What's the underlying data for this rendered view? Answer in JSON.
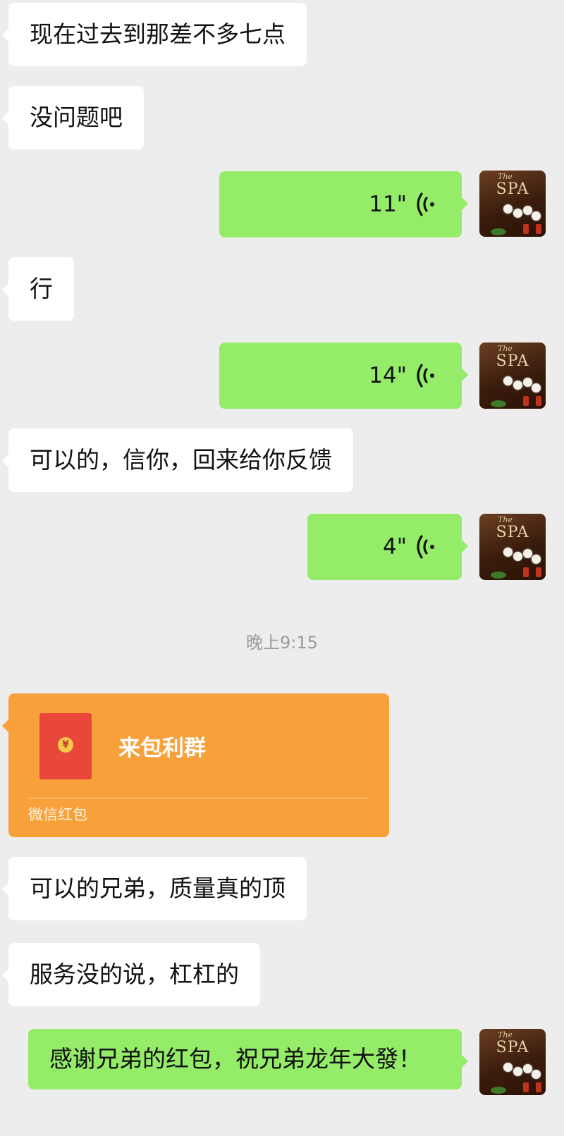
{
  "messages": {
    "m1": "现在过去到那差不多七点",
    "m2": "没问题吧",
    "voice1": "11\"",
    "m3": "行",
    "voice2": "14\"",
    "m4": "可以的，信你，回来给你反馈",
    "voice3": "4\"",
    "timestamp": "晚上9:15",
    "red_packet": {
      "title": "来包利群",
      "label": "微信红包",
      "coin": "¥"
    },
    "m5": "可以的兄弟，质量真的顶",
    "m6": "服务没的说，杠杠的",
    "m7": "感谢兄弟的红包，祝兄弟龙年大發！"
  },
  "avatar": {
    "brand_text": "SPA",
    "brand_prefix": "The"
  },
  "colors": {
    "background": "#ededed",
    "incoming_bubble": "#ffffff",
    "outgoing_bubble": "#95ec69",
    "red_packet": "#f8a13b"
  },
  "icons": {
    "voice": "voice-wave-icon",
    "coin": "yuan-coin-icon"
  }
}
